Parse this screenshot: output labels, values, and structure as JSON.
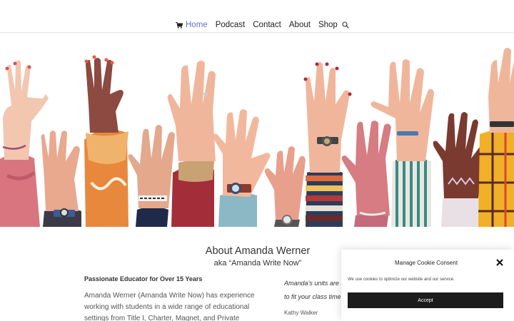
{
  "nav": {
    "items": [
      {
        "label": "Home",
        "active": true
      },
      {
        "label": "Podcast",
        "active": false
      },
      {
        "label": "Contact",
        "active": false
      },
      {
        "label": "About",
        "active": false
      },
      {
        "label": "Shop",
        "active": false
      }
    ],
    "cart_icon": "cart-icon",
    "search_icon": "search-icon",
    "accent_color": "#6b73c7"
  },
  "hero": {
    "image": "raised-hands-illustration"
  },
  "about": {
    "title": "About Amanda Werner",
    "subtitle": "aka “Amanda Write Now”",
    "left_heading": "Passionate Educator for Over 15 Years",
    "left_paragraph": "Amanda Werner (Amanda Write Now) has experience working with students in a wide range of educational settings from Title I, Charter, Magnet, and Private",
    "quote_line1": "Amanda’s units are so",
    "quote_line2": "to fit your class time, a",
    "quote_author": "Kathy Walker"
  },
  "cookie": {
    "title": "Manage Cookie Consent",
    "text": "We use cookies to optimize our website and our service.",
    "accept_label": "Accept",
    "close_icon": "close-icon"
  }
}
